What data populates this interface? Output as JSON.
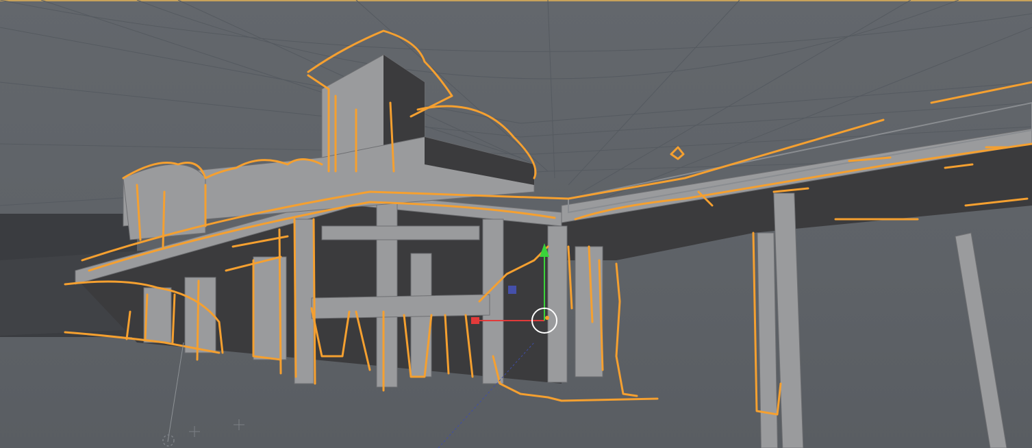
{
  "viewport": {
    "name": "3D Viewport",
    "background": "#5e6267",
    "grid_color": "#555a60",
    "selection_outline_color": "#f5a030",
    "active_border_color": "#c8a25a",
    "mesh_color": "#9a9b9d",
    "mesh_dark_color": "#3b3b3d"
  },
  "gizmo": {
    "type": "move-gizmo",
    "x_axis_color": "#e23a3a",
    "y_axis_color": "#3ad43a",
    "z_axis_color": "#4a5ad8"
  },
  "icons": [
    "move-gizmo-icon",
    "object-origin-icon",
    "3d-cursor-icon",
    "light-object-icon"
  ]
}
